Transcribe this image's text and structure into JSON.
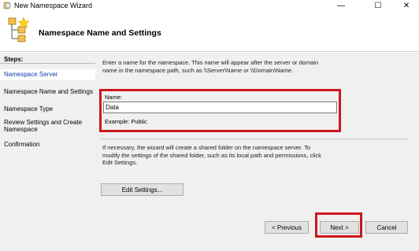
{
  "window": {
    "title": "New Namespace Wizard",
    "controls": {
      "minimize": "—",
      "maximize": "☐",
      "close": "✕"
    }
  },
  "header": {
    "title": "Namespace Name and Settings"
  },
  "steps": {
    "label": "Steps:",
    "items": [
      {
        "label": "Namespace Server",
        "current": true
      },
      {
        "label": "Namespace Name and Settings",
        "current": false
      },
      {
        "label": "Namespace Type",
        "current": false
      },
      {
        "label": "Review Settings and Create Namespace",
        "current": false
      },
      {
        "label": "Confirmation",
        "current": false
      }
    ]
  },
  "content": {
    "description": "Enter a name for the namespace. This name will appear after the server or domain name in the namespace path, such as \\\\Server\\Name or \\\\Domain\\Name.",
    "name_label": "Name:",
    "name_value": "Data",
    "example": "Example: Public",
    "info": "If necessary, the wizard will create a shared folder on the namespace server. To modify the settings of the shared folder, such as its local path and permissions, click Edit Settings.",
    "edit_button": "Edit Settings..."
  },
  "footer": {
    "previous": "< Previous",
    "next": "Next >",
    "cancel": "Cancel"
  },
  "colors": {
    "highlight": "#d0161d",
    "current_step": "#0b3fb0",
    "panel": "#f0f0f0"
  }
}
